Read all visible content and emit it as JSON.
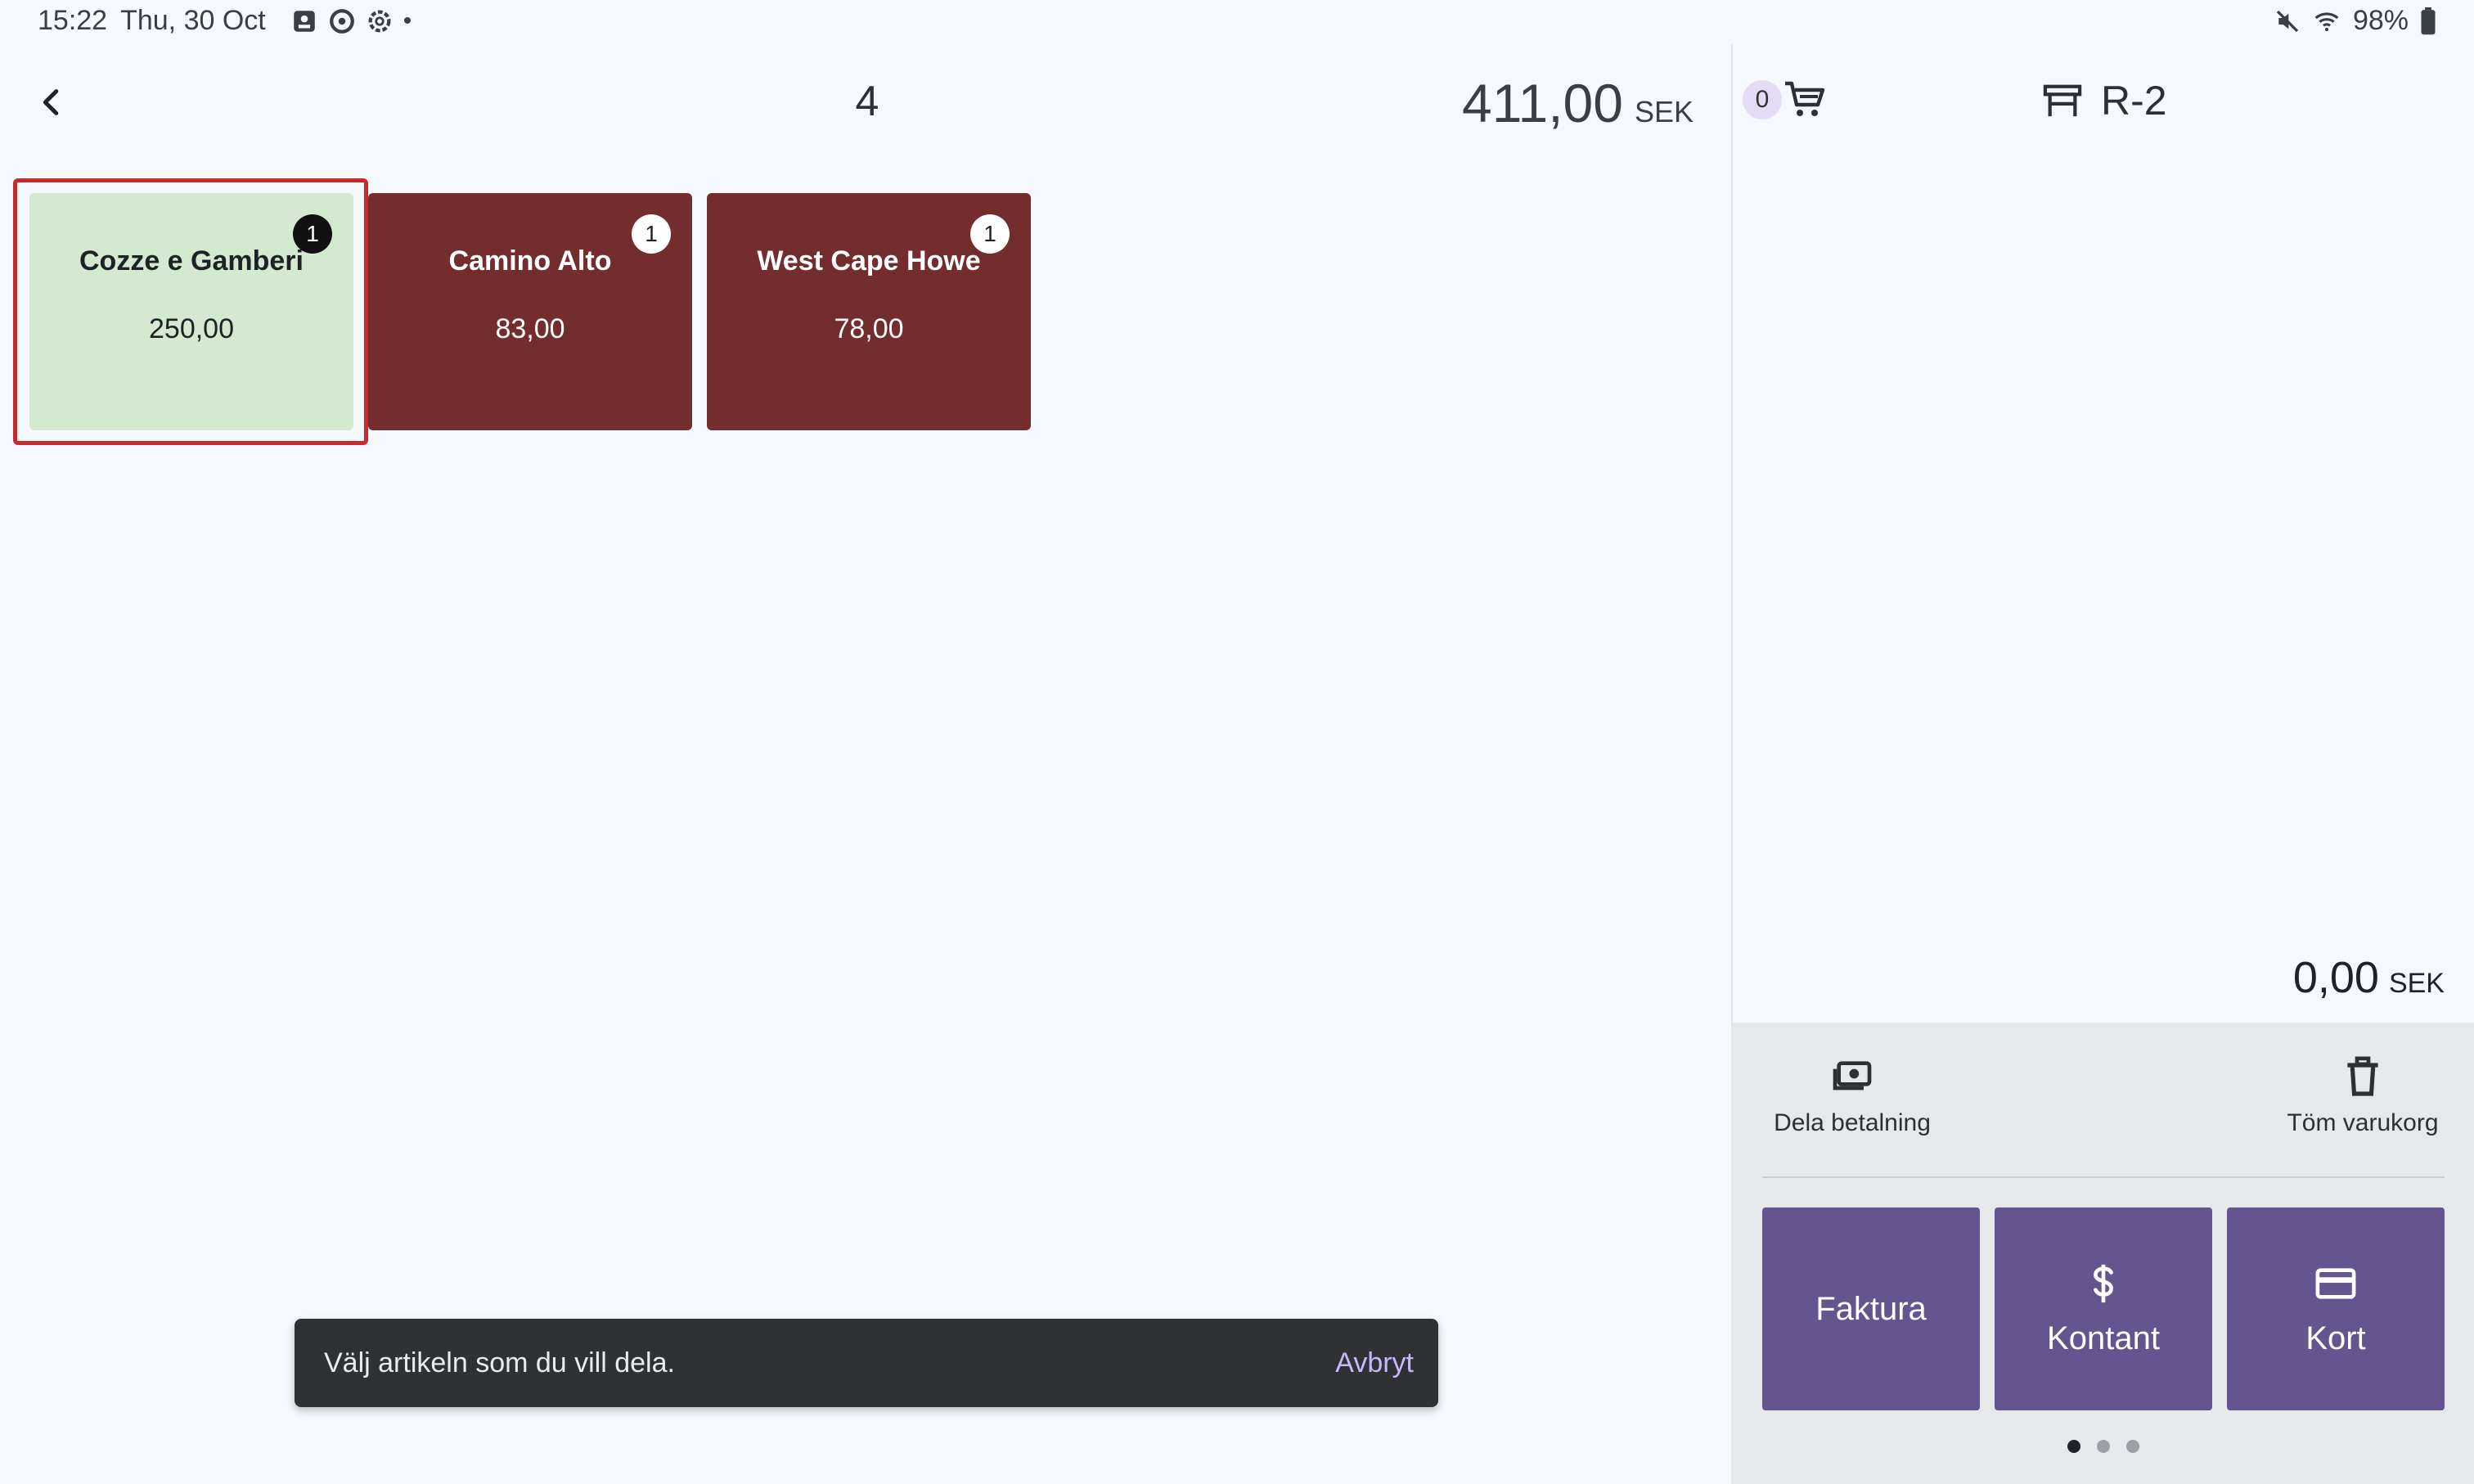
{
  "status_bar": {
    "time": "15:22",
    "date": "Thu, 30 Oct",
    "battery": "98%"
  },
  "order": {
    "item_count": "4",
    "total_amount": "411,00",
    "currency": "SEK"
  },
  "items": [
    {
      "name": "Cozze e Gamberi",
      "price": "250,00",
      "qty": "1",
      "selected": true,
      "color": "#d3e9d0"
    },
    {
      "name": "Camino Alto",
      "price": "83,00",
      "qty": "1",
      "selected": false,
      "color": "#742d2d"
    },
    {
      "name": "West Cape Howe",
      "price": "78,00",
      "qty": "1",
      "selected": false,
      "color": "#742d2d"
    }
  ],
  "snackbar": {
    "message": "Välj artikeln som du vill dela.",
    "action": "Avbryt"
  },
  "cart": {
    "count": "0",
    "table": "R-2",
    "total_amount": "0,00",
    "currency": "SEK"
  },
  "actions": {
    "split_label": "Dela betalning",
    "clear_label": "Töm varukorg"
  },
  "payments": {
    "invoice_label": "Faktura",
    "cash_label": "Kontant",
    "card_label": "Kort",
    "button_color": "#645590"
  },
  "icons": {
    "back": "chevron-left-icon",
    "cart": "cart-icon",
    "table": "table-icon",
    "split": "money-icon",
    "clear": "trash-icon",
    "cash": "dollar-icon",
    "card": "card-icon"
  }
}
